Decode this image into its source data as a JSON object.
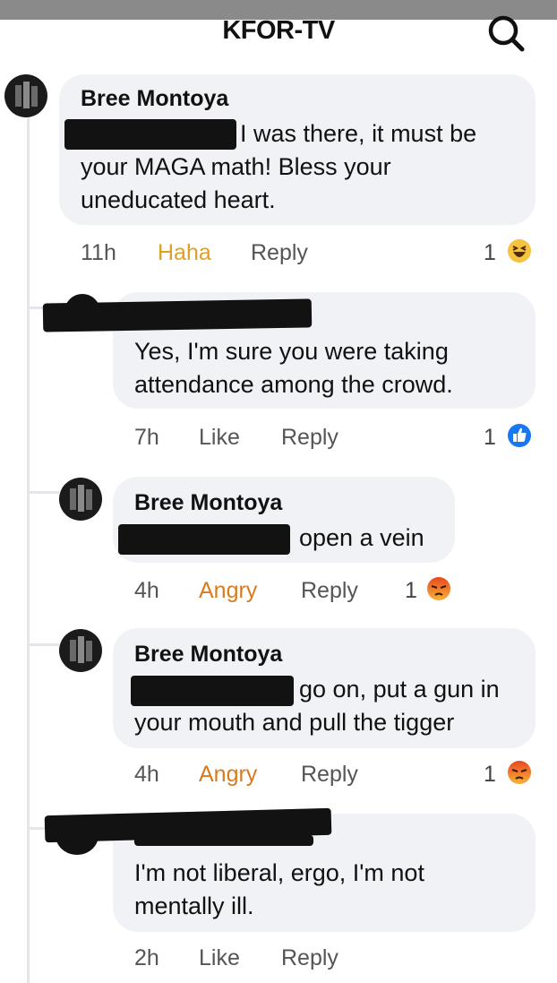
{
  "header": {
    "title": "KFOR-TV",
    "search_icon": "search-icon"
  },
  "comments": [
    {
      "author": "Bree Montoya",
      "text_line1": "I was there, it must be",
      "text_line2": "your MAGA math! Bless your",
      "text_line3": "uneducated heart.",
      "time": "11h",
      "reaction_label": "Haha",
      "reply_label": "Reply",
      "count": "1",
      "reaction_icon": "haha-emoji-icon"
    },
    {
      "author": "",
      "text_line1": "Yes, I'm sure you were taking",
      "text_line2": "attendance among the crowd.",
      "time": "7h",
      "reaction_label": "Like",
      "reply_label": "Reply",
      "count": "1",
      "reaction_icon": "like-thumb-icon"
    },
    {
      "author": "Bree Montoya",
      "text_line1": "open a vein",
      "time": "4h",
      "reaction_label": "Angry",
      "reply_label": "Reply",
      "count": "1",
      "reaction_icon": "angry-emoji-icon"
    },
    {
      "author": "Bree Montoya",
      "text_line1": "go on, put a gun in",
      "text_line2": "your mouth and pull the tigger",
      "time": "4h",
      "reaction_label": "Angry",
      "reply_label": "Reply",
      "count": "1",
      "reaction_icon": "angry-emoji-icon"
    },
    {
      "author": "",
      "text_line1": "I'm not liberal, ergo, I'm not",
      "text_line2": "mentally ill.",
      "time": "2h",
      "reaction_label": "Like",
      "reply_label": "Reply"
    }
  ],
  "colors": {
    "haha": "#e0a021",
    "angry": "#d97a1e",
    "like": "#1877f2",
    "bubble": "#f0f2f5"
  }
}
